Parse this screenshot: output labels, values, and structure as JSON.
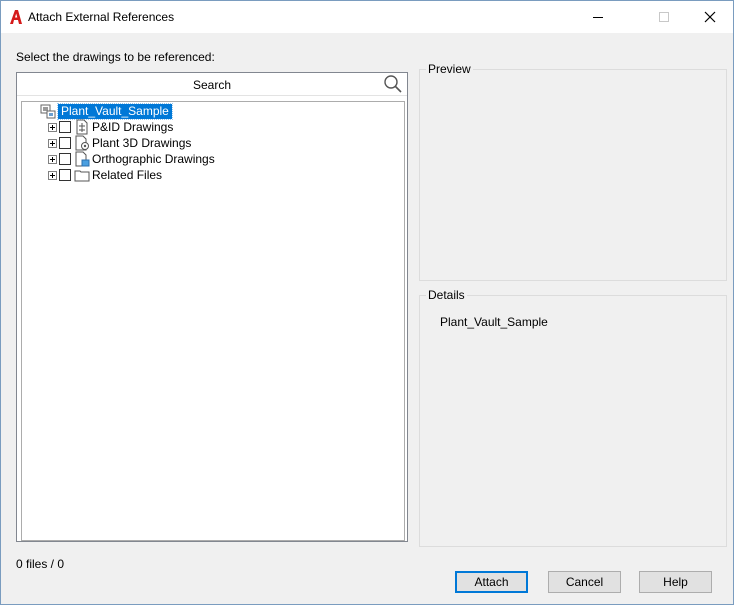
{
  "window": {
    "title": "Attach External References",
    "app_icon": "autocad-a-icon",
    "controls": [
      "minimize-icon",
      "maximize-icon",
      "close-icon"
    ]
  },
  "select_label": "Select the drawings to be referenced:",
  "search": {
    "label": "Search",
    "icon": "search-icon"
  },
  "tree": {
    "root": {
      "label": "Plant_Vault_Sample",
      "icon": "project-vault-icon",
      "selected": true
    },
    "items": [
      {
        "label": "P&ID Drawings",
        "icon": "pid-drawing-icon",
        "checked": false,
        "collapsed": true
      },
      {
        "label": "Plant 3D Drawings",
        "icon": "plant3d-drawing-icon",
        "checked": false,
        "collapsed": true
      },
      {
        "label": "Orthographic Drawings",
        "icon": "ortho-drawing-icon",
        "checked": false,
        "collapsed": true
      },
      {
        "label": "Related Files",
        "icon": "folder-icon",
        "checked": false,
        "collapsed": true
      }
    ]
  },
  "preview": {
    "title": "Preview"
  },
  "details": {
    "title": "Details",
    "text": "Plant_Vault_Sample"
  },
  "status": "0 files / 0",
  "buttons": {
    "attach": "Attach",
    "cancel": "Cancel",
    "help": "Help"
  },
  "colors": {
    "selection": "#0078d7",
    "app_icon_red": "#d51a1a",
    "dialog_bg": "#f0f0f0"
  }
}
